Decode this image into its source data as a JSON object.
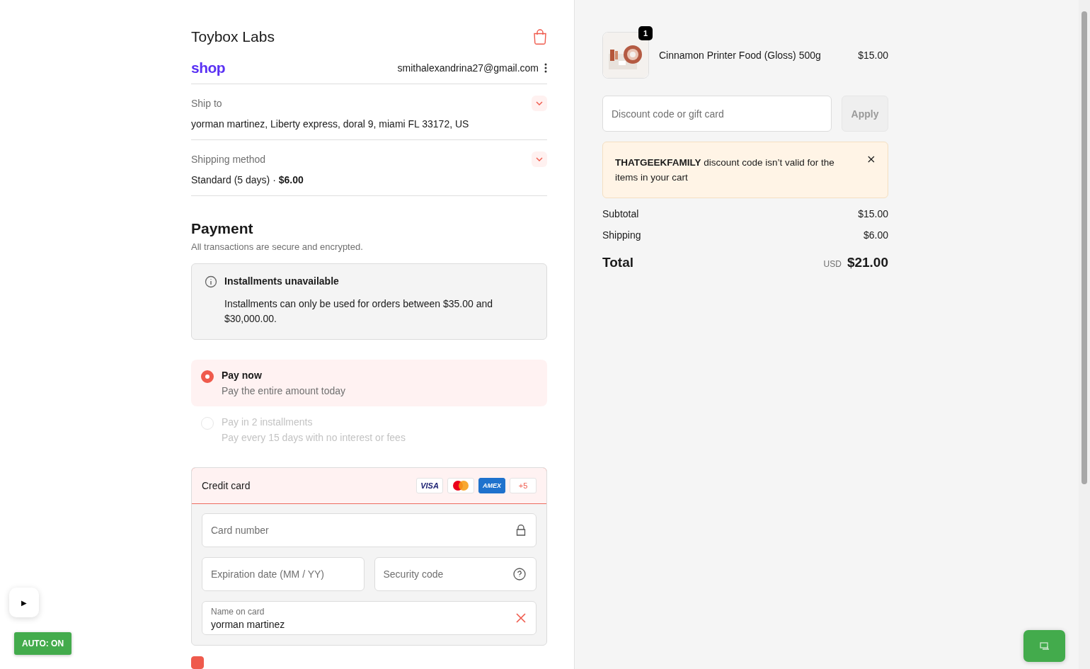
{
  "store": {
    "name": "Toybox Labs"
  },
  "account": {
    "logo": "shop",
    "email": "smithalexandrina27@gmail.com"
  },
  "summary_rows": [
    {
      "label": "Ship to",
      "value": "yorman martinez, Liberty express, doral 9, miami FL 33172, US"
    },
    {
      "label": "Shipping method",
      "value": "Standard (5 days) · **$6.00**"
    }
  ],
  "payment": {
    "title": "Payment",
    "subtitle": "All transactions are secure and encrypted.",
    "notice": {
      "title": "Installments unavailable",
      "text": "Installments can only be used for orders between $35.00 and $30,000.00."
    },
    "options": [
      {
        "label": "Pay now",
        "description": "Pay the entire amount today",
        "selected": true,
        "disabled": false
      },
      {
        "label": "Pay in 2 installments",
        "description": "Pay every 15 days with no interest or fees",
        "selected": false,
        "disabled": true
      }
    ],
    "method": {
      "label": "Credit card",
      "selected": true,
      "brands": [
        {
          "kind": "visa",
          "text": "VISA"
        },
        {
          "kind": "mastercard"
        },
        {
          "kind": "amex",
          "text": "AMEX"
        },
        {
          "kind": "more",
          "text": "+5"
        }
      ]
    },
    "field_rows": [
      [
        {
          "kind": "card_number",
          "placeholder": "Card number"
        }
      ],
      [
        {
          "kind": "expiry",
          "placeholder": "Expiration date (MM / YY)"
        },
        {
          "kind": "security_code",
          "placeholder": "Security code"
        }
      ],
      [
        {
          "kind": "name",
          "label": "Name on card",
          "value": "yorman martinez"
        }
      ]
    ],
    "billing_checkbox": {
      "checked": true
    }
  },
  "cart": {
    "items": [
      {
        "name": "Cinnamon Printer Food (Gloss) 500g",
        "price": "$15.00",
        "quantity": "1"
      }
    ],
    "discount": {
      "placeholder": "Discount code or gift card",
      "button": "Apply",
      "button_disabled": true
    },
    "alert": {
      "text": "**THATGEEKFAMILY** discount code isn’t valid for the items in your cart"
    },
    "rows": [
      {
        "label": "Subtotal",
        "value": "$15.00"
      },
      {
        "label": "Shipping",
        "value": "$6.00"
      }
    ],
    "total": {
      "label": "Total",
      "currency": "USD",
      "amount": "$21.00"
    }
  },
  "overlay": {
    "play": "▶",
    "auto": "AUTO: ON"
  }
}
